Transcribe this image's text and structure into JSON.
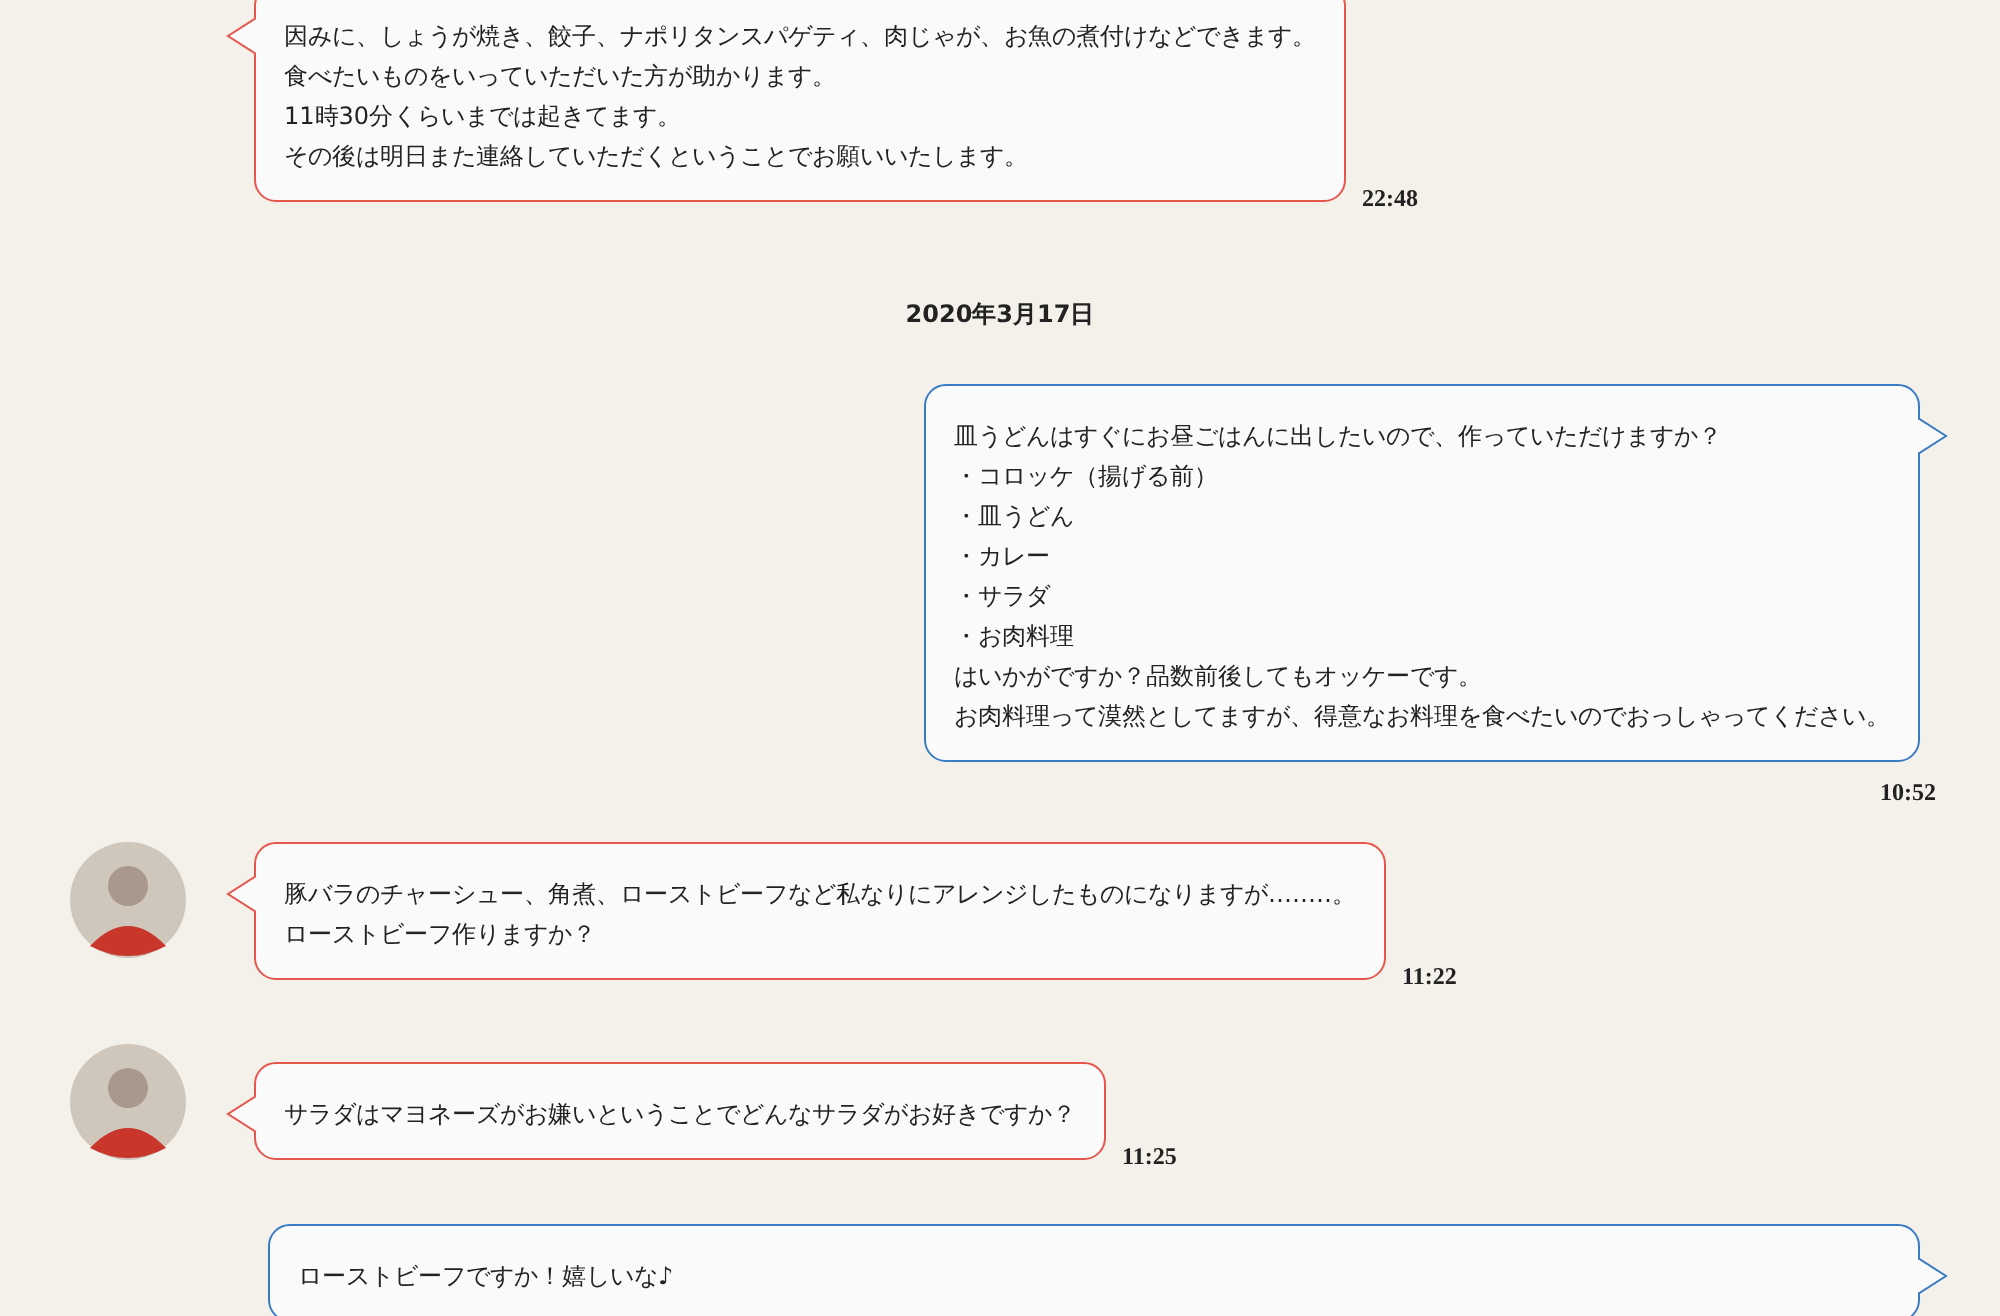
{
  "messages": [
    {
      "kind": "received",
      "avatar": false,
      "lines": [
        "因みに、しょうが焼き、餃子、ナポリタンスパゲティ、肉じゃが、お魚の煮付けなどできます。",
        "食べたいものをいっていただいた方が助かります。",
        "11時30分くらいまでは起きてます。",
        "その後は明日また連絡していただくということでお願いいたします。"
      ],
      "time": "22:48"
    },
    {
      "kind": "date",
      "text": "2020年3月17日"
    },
    {
      "kind": "sent",
      "lines": [
        "皿うどんはすぐにお昼ごはんに出したいので、作っていただけますか？",
        "・コロッケ（揚げる前）",
        "・皿うどん",
        "・カレー",
        "・サラダ",
        "・お肉料理",
        "はいかがですか？品数前後してもオッケーです。",
        "お肉料理って漠然としてますが、得意なお料理を食べたいのでおっしゃってください。"
      ],
      "time": "10:52"
    },
    {
      "kind": "received",
      "avatar": true,
      "lines": [
        "豚バラのチャーシュー、角煮、ローストビーフなど私なりにアレンジしたものになりますが‥……。",
        "ローストビーフ作りますか？"
      ],
      "time": "11:22"
    },
    {
      "kind": "received",
      "avatar": true,
      "lines": [
        "サラダはマヨネーズがお嫌いということでどんなサラダがお好きですか？"
      ],
      "time": "11:25"
    },
    {
      "kind": "sent",
      "wide": true,
      "lines": [
        "ローストビーフですか！嬉しいな♪"
      ]
    }
  ]
}
